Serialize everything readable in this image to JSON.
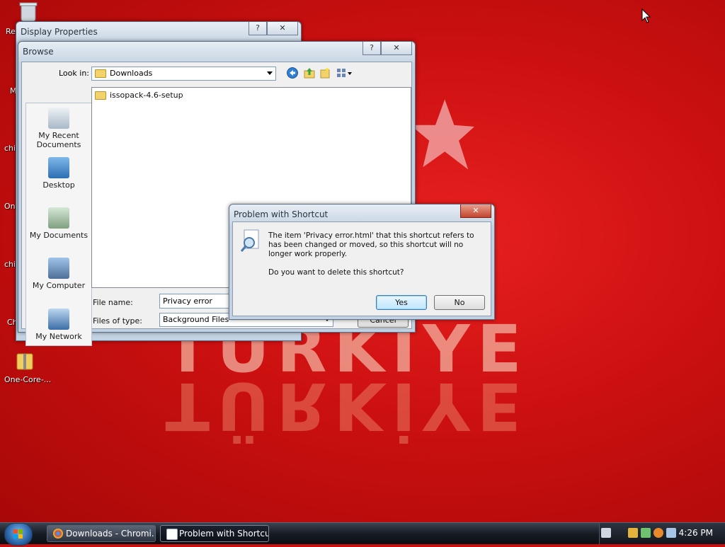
{
  "desktop": {
    "wallpaper_text": "TÜRKİYE",
    "icons": [
      {
        "label": "Re",
        "icon": "recycle-bin-icon"
      },
      {
        "label": "M",
        "icon": "computer-icon"
      },
      {
        "label": "chi",
        "icon": "shortcut-icon"
      },
      {
        "label": "On",
        "icon": "shortcut-icon"
      },
      {
        "label": "chi",
        "icon": "shortcut-icon"
      },
      {
        "label": "Ch",
        "icon": "shortcut-icon"
      },
      {
        "label": "One-Core-...",
        "icon": "zip-folder-icon"
      }
    ]
  },
  "display_properties": {
    "title": "Display Properties",
    "help_label": "?",
    "close_label": "✕"
  },
  "browse": {
    "title": "Browse",
    "help_label": "?",
    "close_label": "✕",
    "look_in_label": "Look in:",
    "look_in_value": "Downloads",
    "places": [
      {
        "label": "My Recent Documents",
        "icon": "recent-documents-icon"
      },
      {
        "label": "Desktop",
        "icon": "desktop-icon"
      },
      {
        "label": "My Documents",
        "icon": "my-documents-icon"
      },
      {
        "label": "My Computer",
        "icon": "my-computer-icon"
      },
      {
        "label": "My Network",
        "icon": "my-network-icon"
      }
    ],
    "files": [
      {
        "name": "issopack-4.6-setup",
        "icon": "folder-icon"
      }
    ],
    "file_name_label": "File name:",
    "file_name_value": "Privacy error",
    "files_of_type_label": "Files of type:",
    "files_of_type_value": "Background Files",
    "cancel_label": "Cancel"
  },
  "problem_dialog": {
    "title": "Problem with Shortcut",
    "close_label": "✕",
    "message": "The item 'Privacy error.html' that this shortcut refers to has been changed or moved, so this shortcut will no longer work properly.",
    "question": "Do you want to delete this shortcut?",
    "yes_label": "Yes",
    "no_label": "No"
  },
  "taskbar": {
    "tasks": [
      {
        "label": "Downloads - Chromi...",
        "icon": "chrome-icon",
        "active": false
      },
      {
        "label": "Problem with Shortcut",
        "icon": "window-icon",
        "active": true
      }
    ],
    "clock": "4:26 PM"
  },
  "colors": {
    "wallpaper": "#c81010",
    "taskbar": "#171c24",
    "title_text": "#2a3440"
  }
}
